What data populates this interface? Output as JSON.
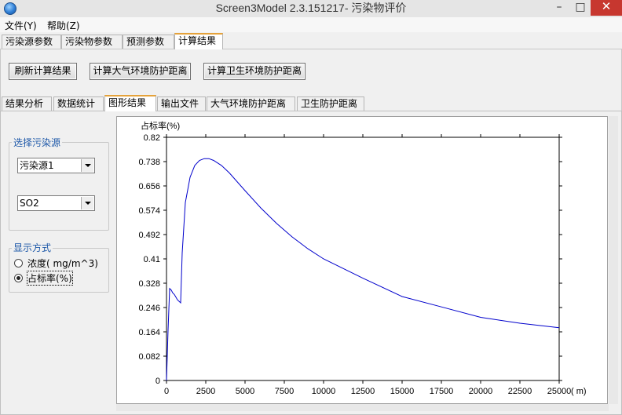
{
  "window": {
    "title": "Screen3Model 2.3.151217- 污染物评价",
    "min_glyph": "–",
    "max_glyph": "□",
    "close_glyph": "✕"
  },
  "menu": {
    "file": "文件(Y)",
    "help": "帮助(Z)"
  },
  "main_tabs": {
    "t1": "污染源参数",
    "t2": "污染物参数",
    "t3": "预测参数",
    "t4": "计算结果"
  },
  "actions": {
    "refresh": "刷新计算结果",
    "air_distance": "计算大气环境防护距离",
    "health_distance": "计算卫生环境防护距离"
  },
  "sub_tabs": {
    "t1": "结果分析",
    "t2": "数据统计",
    "t3": "图形结果",
    "t4": "输出文件",
    "t5": "大气环境防护距离",
    "t6": "卫生防护距离"
  },
  "source_group": {
    "title": "选择污染源",
    "source_value": "污染源1",
    "pollutant_value": "SO2"
  },
  "display_group": {
    "title": "显示方式",
    "opt_concentration": "浓度( mg/m^3)",
    "opt_ratio": "占标率(%)"
  },
  "chart_data": {
    "type": "line",
    "ylabel": "占标率(%)",
    "xunit": "( m)",
    "ylim": [
      0,
      0.82
    ],
    "xlim": [
      0,
      25000
    ],
    "yticks": [
      0,
      0.082,
      0.164,
      0.246,
      0.328,
      0.41,
      0.492,
      0.574,
      0.656,
      0.738,
      0.82
    ],
    "ytick_labels": [
      "0",
      "0.082",
      "0.164",
      "0.246",
      "0.328",
      "0.41",
      "0.492",
      "0.574",
      "0.656",
      "0.738",
      "0.82"
    ],
    "xticks": [
      0,
      2500,
      5000,
      7500,
      10000,
      12500,
      15000,
      17500,
      20000,
      22500,
      25000
    ],
    "xtick_labels": [
      "0",
      "2500",
      "5000",
      "7500",
      "10000",
      "12500",
      "15000",
      "17500",
      "20000",
      "22500",
      "25000"
    ],
    "line_color": "#0000cc",
    "x": [
      0,
      100,
      200,
      300,
      400,
      500,
      700,
      900,
      1000,
      1200,
      1500,
      1800,
      2100,
      2400,
      2700,
      3000,
      3500,
      4000,
      5000,
      6000,
      7000,
      8000,
      9000,
      10000,
      12500,
      15000,
      17500,
      20000,
      22500,
      25000
    ],
    "y": [
      0,
      0.17,
      0.31,
      0.305,
      0.295,
      0.29,
      0.272,
      0.262,
      0.43,
      0.6,
      0.685,
      0.725,
      0.742,
      0.748,
      0.748,
      0.742,
      0.725,
      0.7,
      0.64,
      0.582,
      0.53,
      0.484,
      0.444,
      0.41,
      0.345,
      0.283,
      0.248,
      0.213,
      0.193,
      0.178
    ]
  }
}
